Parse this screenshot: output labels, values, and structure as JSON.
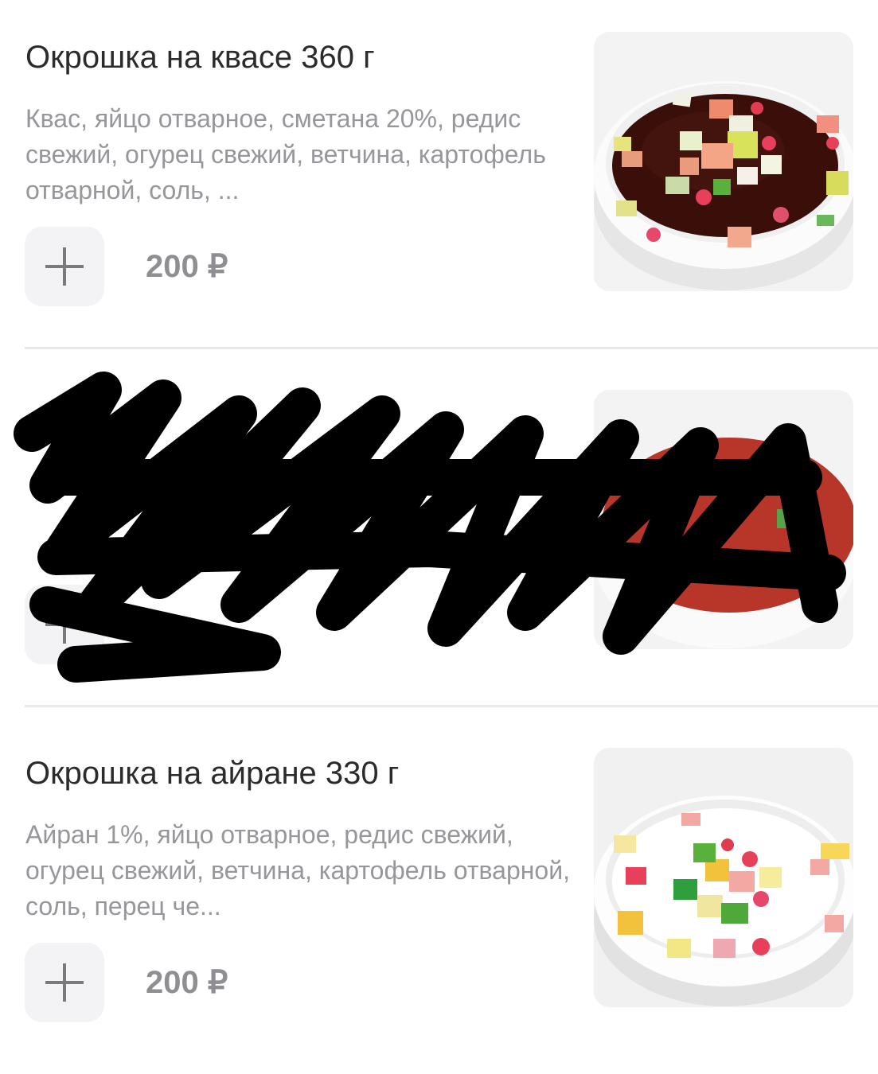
{
  "items": [
    {
      "title": "Окрошка на квасе 360 г",
      "description": "Квас, яйцо отварное, сметана 20%, редис свежий, огурец свежий, ветчина, картофель отварной, соль, ...",
      "price": "200 ₽",
      "image": "okroshka-kvas-photo"
    },
    {
      "title": "",
      "description": "",
      "price": "",
      "image": "tomato-soup-photo",
      "redacted": true
    },
    {
      "title": "Окрошка на айране 330 г",
      "description": "Айран 1%, яйцо отварное, редис свежий, огурец свежий, ветчина, картофель отварной, соль, перец че...",
      "price": "200 ₽",
      "image": "okroshka-ayran-photo"
    }
  ],
  "icons": {
    "add": "plus-icon"
  },
  "colors": {
    "title": "#2b2b2b",
    "description": "#96969b",
    "price": "#8e8e93",
    "button_bg": "#f3f3f5",
    "divider": "#e9e9ec",
    "kvas_soup": "#3a0f0a",
    "tomato_soup": "#b8352a",
    "ayran_soup": "#ffffff",
    "redaction": "#000000"
  }
}
